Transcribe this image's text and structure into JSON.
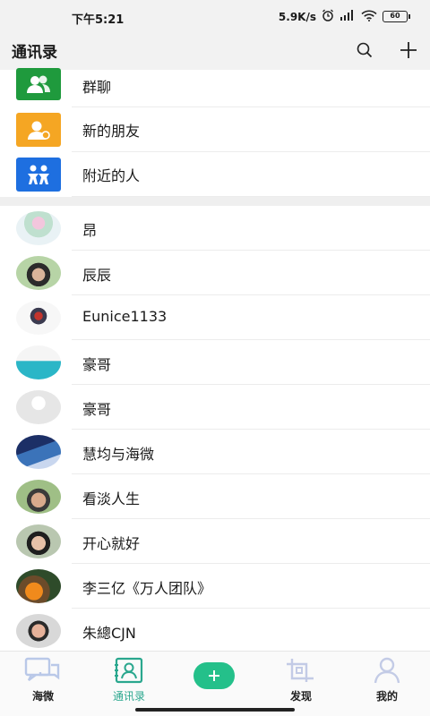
{
  "status_bar": {
    "time": "下午5:21",
    "speed": "5.9K/s",
    "battery": "60"
  },
  "header": {
    "title": "通讯录"
  },
  "features": [
    {
      "label": "群聊",
      "color": "#1f9a3d",
      "icon": "group-icon"
    },
    {
      "label": "新的朋友",
      "color": "#f5a623",
      "icon": "add-friend-icon"
    },
    {
      "label": "附近的人",
      "color": "#1e6fe0",
      "icon": "nearby-icon"
    }
  ],
  "contacts": [
    {
      "name": "昂"
    },
    {
      "name": "辰辰"
    },
    {
      "name": "Eunice1133"
    },
    {
      "name": "豪哥"
    },
    {
      "name": "豪哥"
    },
    {
      "name": "慧均与海微"
    },
    {
      "name": "看淡人生"
    },
    {
      "name": "开心就好"
    },
    {
      "name": "李三亿《万人团队》"
    },
    {
      "name": "朱總CJN"
    }
  ],
  "tabs": [
    {
      "label": "海微"
    },
    {
      "label": "通讯录"
    },
    {
      "label": "发现"
    },
    {
      "label": "我的"
    }
  ],
  "colors": {
    "accent": "#2aa78e",
    "center_button": "#24c08a"
  }
}
